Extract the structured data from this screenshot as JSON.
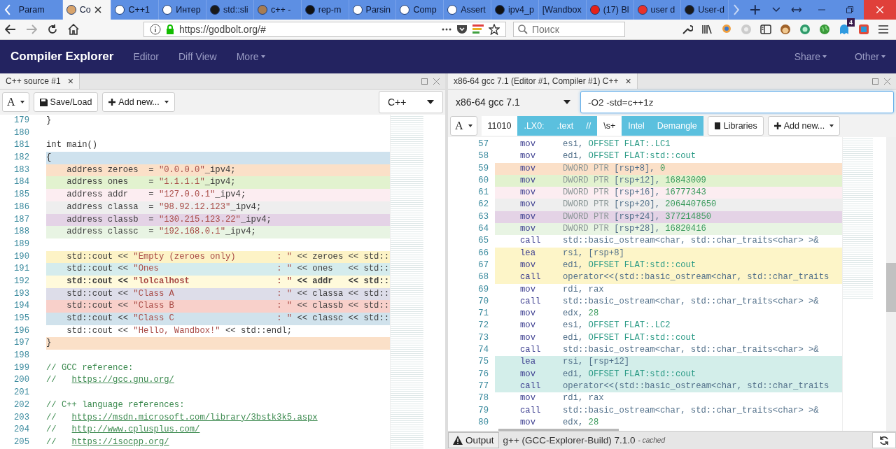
{
  "browser_tabs": [
    {
      "label": "Param",
      "selected": false
    },
    {
      "label": "Co",
      "selected": true,
      "color": "#d9a46b"
    },
    {
      "label": "C++1",
      "selected": false,
      "color": "#ffffff"
    },
    {
      "label": "Интер",
      "selected": false,
      "color": "#ffffff"
    },
    {
      "label": "std::sli",
      "selected": false,
      "color": "#1a1a1a"
    },
    {
      "label": "c++ -",
      "selected": false,
      "color": "#a67c52"
    },
    {
      "label": "rep-m",
      "selected": false,
      "color": "#111111"
    },
    {
      "label": "Parsin",
      "selected": false,
      "color": "#ffffff"
    },
    {
      "label": "Comp",
      "selected": false,
      "color": "#ffffff"
    },
    {
      "label": "Assert",
      "selected": false,
      "color": "#ffffff"
    },
    {
      "label": "ipv4_p",
      "selected": false,
      "color": "#111111"
    },
    {
      "label": "[Wandbox",
      "selected": false
    },
    {
      "label": "(17) Bl",
      "selected": false,
      "color": "#e62117"
    },
    {
      "label": "user d",
      "selected": false,
      "color": "#e8312a"
    },
    {
      "label": "User-d",
      "selected": false,
      "color": "#1a1a1a"
    }
  ],
  "url": "https://godbolt.org/#",
  "search": {
    "placeholder": "Поиск"
  },
  "extension_badge": "4",
  "site": {
    "brand": "Compiler Explorer",
    "nav": [
      "Editor",
      "Diff View",
      "More"
    ],
    "nav_right": [
      "Share",
      "Other"
    ]
  },
  "source_pane": {
    "tab": "C++ source #1",
    "close": "×",
    "font_button": "A",
    "buttons": [
      "Save/Load",
      "Add new..."
    ],
    "language": "C++",
    "lines": [
      {
        "num": "179",
        "bold": false,
        "parts": [
          {
            "kind": "plain",
            "text": "}"
          }
        ]
      },
      {
        "num": "180"
      },
      {
        "num": "181",
        "bold": false,
        "parts": [
          {
            "kind": "plain",
            "text": "int main()"
          }
        ]
      },
      {
        "num": "182",
        "bold": false,
        "color": "#cfe2ee",
        "parts": [
          {
            "kind": "plain",
            "text": "{"
          }
        ]
      },
      {
        "num": "183",
        "bold": false,
        "color": "#fbe0c8",
        "parts": [
          {
            "kind": "plain",
            "text": "    address zeroes  = "
          },
          {
            "kind": "string",
            "text": "\"0.0.0.0\""
          },
          {
            "kind": "plain",
            "text": "_ipv4;"
          }
        ]
      },
      {
        "num": "184",
        "bold": false,
        "color": "#e2f2cf",
        "parts": [
          {
            "kind": "plain",
            "text": "    address ones    = "
          },
          {
            "kind": "string",
            "text": "\"1.1.1.1\""
          },
          {
            "kind": "plain",
            "text": "_ipv4;"
          }
        ]
      },
      {
        "num": "185",
        "bold": false,
        "color": "#fcedf1",
        "parts": [
          {
            "kind": "plain",
            "text": "    address addr    = "
          },
          {
            "kind": "string",
            "text": "\"127.0.0.1\""
          },
          {
            "kind": "plain",
            "text": "_ipv4;"
          }
        ]
      },
      {
        "num": "186",
        "bold": false,
        "color": "#eeeeee",
        "parts": [
          {
            "kind": "plain",
            "text": "    address classa  = "
          },
          {
            "kind": "string",
            "text": "\"98.92.12.123\""
          },
          {
            "kind": "plain",
            "text": "_ipv4;"
          }
        ]
      },
      {
        "num": "187",
        "bold": false,
        "color": "#e4d3e6",
        "parts": [
          {
            "kind": "plain",
            "text": "    address classb  = "
          },
          {
            "kind": "string",
            "text": "\"130.215.123.22\""
          },
          {
            "kind": "plain",
            "text": "_ipv4;"
          }
        ]
      },
      {
        "num": "188",
        "bold": false,
        "color": "#e8f4e3",
        "parts": [
          {
            "kind": "plain",
            "text": "    address classc  = "
          },
          {
            "kind": "string",
            "text": "\"192.168.0.1\""
          },
          {
            "kind": "plain",
            "text": "_ipv4;"
          }
        ]
      },
      {
        "num": "189"
      },
      {
        "num": "190",
        "bold": false,
        "color": "#fdf3c6",
        "parts": [
          {
            "kind": "plain",
            "text": "    std::cout << "
          },
          {
            "kind": "string",
            "text": "\"Empty (zeroes only)        : \""
          },
          {
            "kind": "plain",
            "text": " << zeroes << std::"
          }
        ]
      },
      {
        "num": "191",
        "bold": false,
        "color": "#d5eced",
        "parts": [
          {
            "kind": "plain",
            "text": "    std::cout << "
          },
          {
            "kind": "string",
            "text": "\"Ones                       : \""
          },
          {
            "kind": "plain",
            "text": " << ones   << std::"
          }
        ]
      },
      {
        "num": "192",
        "bold": true,
        "color": "#fffadb",
        "parts": [
          {
            "kind": "plain",
            "text": "    std::cout << "
          },
          {
            "kind": "string",
            "text": "\"lolcalhost                 : \""
          },
          {
            "kind": "plain",
            "text": " << addr   << std::"
          }
        ]
      },
      {
        "num": "193",
        "bold": false,
        "color": "#dddde9",
        "parts": [
          {
            "kind": "plain",
            "text": "    std::cout << "
          },
          {
            "kind": "string",
            "text": "\"Class A                    : \""
          },
          {
            "kind": "plain",
            "text": " << classa << std::"
          }
        ]
      },
      {
        "num": "194",
        "bold": false,
        "color": "#f8d0ca",
        "parts": [
          {
            "kind": "plain",
            "text": "    std::cout << "
          },
          {
            "kind": "string",
            "text": "\"Class B                    : \""
          },
          {
            "kind": "plain",
            "text": " << classb << std::"
          }
        ]
      },
      {
        "num": "195",
        "bold": false,
        "color": "#d0e2ec",
        "parts": [
          {
            "kind": "plain",
            "text": "    std::cout << "
          },
          {
            "kind": "string",
            "text": "\"Class C                    : \""
          },
          {
            "kind": "plain",
            "text": " << classc << std::"
          }
        ]
      },
      {
        "num": "196",
        "bold": false,
        "parts": [
          {
            "kind": "plain",
            "text": "    std::cout << "
          },
          {
            "kind": "string",
            "text": "\"Hello, Wandbox!\""
          },
          {
            "kind": "plain",
            "text": " << std::endl;"
          }
        ]
      },
      {
        "num": "197",
        "bold": false,
        "color": "#fbe0c8",
        "parts": [
          {
            "kind": "plain",
            "text": "}"
          }
        ]
      },
      {
        "num": "198"
      },
      {
        "num": "199",
        "bold": false,
        "parts": [
          {
            "kind": "comment",
            "text": "// GCC reference:"
          }
        ]
      },
      {
        "num": "200",
        "bold": false,
        "parts": [
          {
            "kind": "comment",
            "text": "//   "
          },
          {
            "kind": "link",
            "text": "https://gcc.gnu.org/"
          }
        ]
      },
      {
        "num": "201"
      },
      {
        "num": "202",
        "bold": false,
        "parts": [
          {
            "kind": "comment",
            "text": "// C++ language references:"
          }
        ]
      },
      {
        "num": "203",
        "bold": false,
        "parts": [
          {
            "kind": "comment",
            "text": "//   "
          },
          {
            "kind": "link",
            "text": "https://msdn.microsoft.com/library/3bstk3k5.aspx"
          }
        ]
      },
      {
        "num": "204",
        "bold": false,
        "parts": [
          {
            "kind": "comment",
            "text": "//   "
          },
          {
            "kind": "link",
            "text": "http://www.cplusplus.com/"
          }
        ]
      },
      {
        "num": "205",
        "bold": false,
        "parts": [
          {
            "kind": "comment",
            "text": "//   "
          },
          {
            "kind": "link",
            "text": "https://isocpp.org/"
          }
        ]
      }
    ]
  },
  "compiler_pane": {
    "tab": "x86-64 gcc 7.1 (Editor #1, Compiler #1) C++",
    "close": "×",
    "font_button": "A",
    "compiler": "x86-64 gcc 7.1",
    "options": "-O2 -std=c++1z",
    "filters": [
      {
        "label": "11010",
        "selected": false
      },
      {
        "label": ".LX0:",
        "selected": true
      },
      {
        "label": ".text",
        "selected": true
      },
      {
        "label": "//",
        "selected": true
      },
      {
        "label": "\\s+",
        "selected": false
      },
      {
        "label": "Intel",
        "selected": true
      },
      {
        "label": "Demangle",
        "selected": true
      }
    ],
    "buttons": [
      "Libraries",
      "Add new..."
    ],
    "lines": [
      {
        "num": "57",
        "op": "mov",
        "args": [
          {
            "kind": "reg",
            "text": "esi, "
          },
          {
            "kind": "sym",
            "text": "OFFSET FLAT:.LC1"
          }
        ]
      },
      {
        "num": "58",
        "op": "mov",
        "args": [
          {
            "kind": "reg",
            "text": "edi, "
          },
          {
            "kind": "sym",
            "text": "OFFSET FLAT:std::cout"
          }
        ]
      },
      {
        "num": "59",
        "op": "mov",
        "color": "#fbe0c8",
        "args": [
          {
            "kind": "ptr",
            "text": "DWORD PTR "
          },
          {
            "kind": "reg",
            "text": "[rsp+8], "
          },
          {
            "kind": "num",
            "text": "0"
          }
        ]
      },
      {
        "num": "60",
        "op": "mov",
        "color": "#e2f2cf",
        "args": [
          {
            "kind": "ptr",
            "text": "DWORD PTR "
          },
          {
            "kind": "reg",
            "text": "[rsp+12], "
          },
          {
            "kind": "num",
            "text": "16843009"
          }
        ]
      },
      {
        "num": "61",
        "op": "mov",
        "color": "#fcedf1",
        "args": [
          {
            "kind": "ptr",
            "text": "DWORD PTR "
          },
          {
            "kind": "reg",
            "text": "[rsp+16], "
          },
          {
            "kind": "num",
            "text": "16777343"
          }
        ]
      },
      {
        "num": "62",
        "op": "mov",
        "color": "#eeeeee",
        "args": [
          {
            "kind": "ptr",
            "text": "DWORD PTR "
          },
          {
            "kind": "reg",
            "text": "[rsp+20], "
          },
          {
            "kind": "num",
            "text": "2064407650"
          }
        ]
      },
      {
        "num": "63",
        "op": "mov",
        "color": "#e4d3e6",
        "args": [
          {
            "kind": "ptr",
            "text": "DWORD PTR "
          },
          {
            "kind": "reg",
            "text": "[rsp+24], "
          },
          {
            "kind": "num",
            "text": "377214850"
          }
        ]
      },
      {
        "num": "64",
        "op": "mov",
        "color": "#e8f4e3",
        "args": [
          {
            "kind": "ptr",
            "text": "DWORD PTR "
          },
          {
            "kind": "reg",
            "text": "[rsp+28], "
          },
          {
            "kind": "num",
            "text": "16820416"
          }
        ]
      },
      {
        "num": "65",
        "op": "call",
        "args": [
          {
            "kind": "reg",
            "text": "std::basic_ostream<char, std::char_traits<char> >&"
          }
        ]
      },
      {
        "num": "66",
        "op": "lea",
        "color": "#fdf5c8",
        "args": [
          {
            "kind": "reg",
            "text": "rsi, [rsp+8]"
          }
        ]
      },
      {
        "num": "67",
        "op": "mov",
        "color": "#fdf5c8",
        "args": [
          {
            "kind": "reg",
            "text": "edi, "
          },
          {
            "kind": "sym",
            "text": "OFFSET FLAT:std::cout"
          }
        ]
      },
      {
        "num": "68",
        "op": "call",
        "color": "#fdf5c8",
        "args": [
          {
            "kind": "reg",
            "text": "operator<<(std::basic_ostream<char, std::char_traits"
          }
        ]
      },
      {
        "num": "69",
        "op": "mov",
        "args": [
          {
            "kind": "reg",
            "text": "rdi, rax"
          }
        ]
      },
      {
        "num": "70",
        "op": "call",
        "args": [
          {
            "kind": "reg",
            "text": "std::basic_ostream<char, std::char_traits<char> >&"
          }
        ]
      },
      {
        "num": "71",
        "op": "mov",
        "args": [
          {
            "kind": "reg",
            "text": "edx, "
          },
          {
            "kind": "num",
            "text": "28"
          }
        ]
      },
      {
        "num": "72",
        "op": "mov",
        "args": [
          {
            "kind": "reg",
            "text": "esi, "
          },
          {
            "kind": "sym",
            "text": "OFFSET FLAT:.LC2"
          }
        ]
      },
      {
        "num": "73",
        "op": "mov",
        "args": [
          {
            "kind": "reg",
            "text": "edi, "
          },
          {
            "kind": "sym",
            "text": "OFFSET FLAT:std::cout"
          }
        ]
      },
      {
        "num": "74",
        "op": "call",
        "args": [
          {
            "kind": "reg",
            "text": "std::basic_ostream<char, std::char_traits<char> >&"
          }
        ]
      },
      {
        "num": "75",
        "op": "lea",
        "color": "#d3eeea",
        "args": [
          {
            "kind": "reg",
            "text": "rsi, [rsp+12]"
          }
        ]
      },
      {
        "num": "76",
        "op": "mov",
        "color": "#d3eeea",
        "args": [
          {
            "kind": "reg",
            "text": "edi, "
          },
          {
            "kind": "sym",
            "text": "OFFSET FLAT:std::cout"
          }
        ]
      },
      {
        "num": "77",
        "op": "call",
        "color": "#d3eeea",
        "args": [
          {
            "kind": "reg",
            "text": "operator<<(std::basic_ostream<char, std::char_traits"
          }
        ]
      },
      {
        "num": "78",
        "op": "mov",
        "args": [
          {
            "kind": "reg",
            "text": "rdi, rax"
          }
        ]
      },
      {
        "num": "79",
        "op": "call",
        "args": [
          {
            "kind": "reg",
            "text": "std::basic_ostream<char, std::char_traits<char> >&"
          }
        ]
      },
      {
        "num": "80",
        "op": "mov",
        "args": [
          {
            "kind": "reg",
            "text": "edx, "
          },
          {
            "kind": "num",
            "text": "28"
          }
        ]
      }
    ],
    "status": {
      "output": "Output",
      "compiler_info": "g++ (GCC-Explorer-Build) 7.1.0",
      "cached": "- cached"
    }
  }
}
